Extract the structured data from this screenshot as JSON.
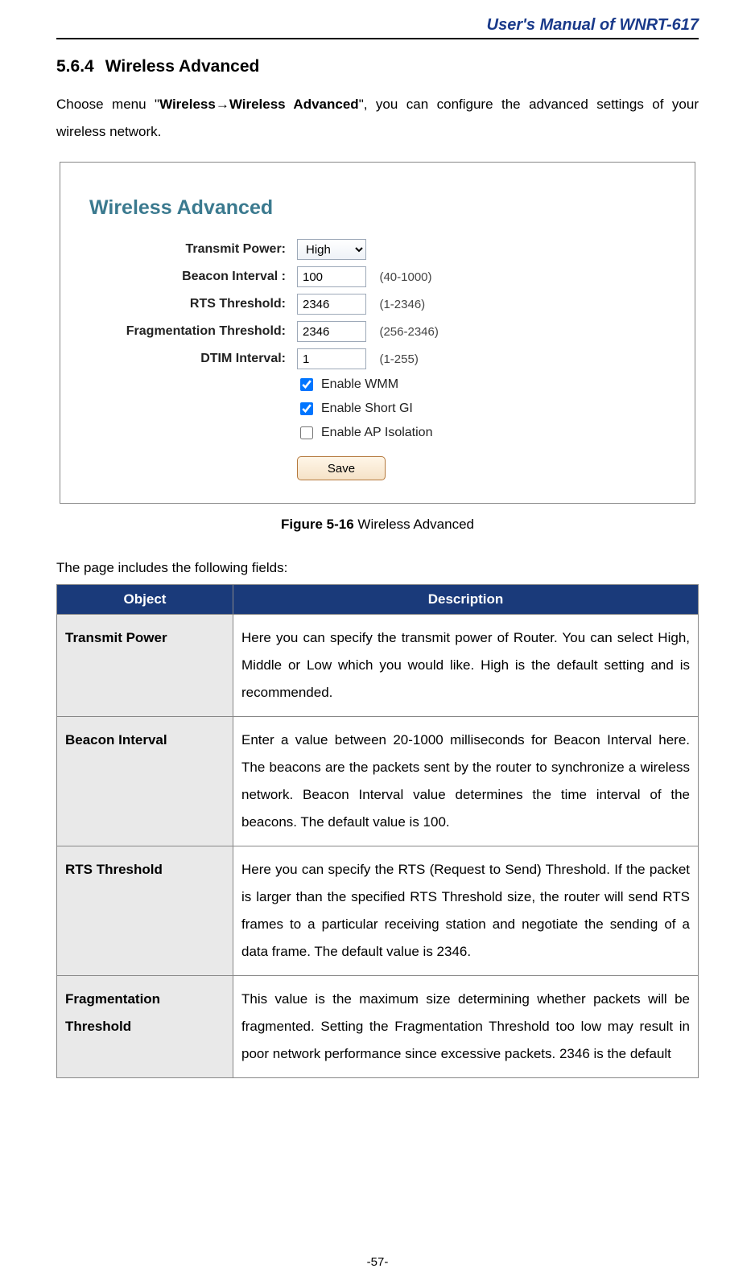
{
  "header": {
    "doc_title": "User's Manual of WNRT-617"
  },
  "section": {
    "number": "5.6.4",
    "title": "Wireless Advanced"
  },
  "intro": {
    "pre": "Choose menu \"",
    "menu_path": "Wireless→Wireless Advanced",
    "post": "\", you can configure the advanced settings of your wireless network."
  },
  "panel": {
    "title": "Wireless Advanced",
    "rows": {
      "transmit_power": {
        "label": "Transmit Power:",
        "value": "High"
      },
      "beacon_interval": {
        "label": "Beacon Interval :",
        "value": "100",
        "hint": "(40-1000)"
      },
      "rts_threshold": {
        "label": "RTS Threshold:",
        "value": "2346",
        "hint": "(1-2346)"
      },
      "frag_threshold": {
        "label": "Fragmentation Threshold:",
        "value": "2346",
        "hint": "(256-2346)"
      },
      "dtim_interval": {
        "label": "DTIM Interval:",
        "value": "1",
        "hint": "(1-255)"
      }
    },
    "checks": {
      "wmm": "Enable WMM",
      "short_gi": "Enable Short GI",
      "ap_isolation": "Enable AP Isolation"
    },
    "save_label": "Save"
  },
  "figure": {
    "bold": "Figure 5-16",
    "rest": " Wireless Advanced"
  },
  "fields_intro": "The page includes the following fields:",
  "table": {
    "head_object": "Object",
    "head_description": "Description",
    "rows": [
      {
        "object": "Transmit Power",
        "description": "Here you can specify the transmit power of Router. You can select High, Middle or Low which you would like. High is the default setting and is recommended."
      },
      {
        "object": "Beacon Interval",
        "description": "Enter a value between 20-1000 milliseconds for Beacon Interval here. The beacons are the packets sent by the router to synchronize a wireless network. Beacon Interval value determines the time interval of the beacons. The default value is 100."
      },
      {
        "object": "RTS Threshold",
        "description": "Here you can specify the RTS (Request to Send) Threshold. If the packet is larger than the specified RTS Threshold size, the router will send RTS frames to a particular receiving station and negotiate the sending of a data frame. The default value is 2346."
      },
      {
        "object": "Fragmentation Threshold",
        "description": "This value is the maximum size determining whether packets will be fragmented. Setting the Fragmentation Threshold too low may result in poor network performance since excessive packets. 2346 is the default"
      }
    ]
  },
  "page_number": "-57-"
}
